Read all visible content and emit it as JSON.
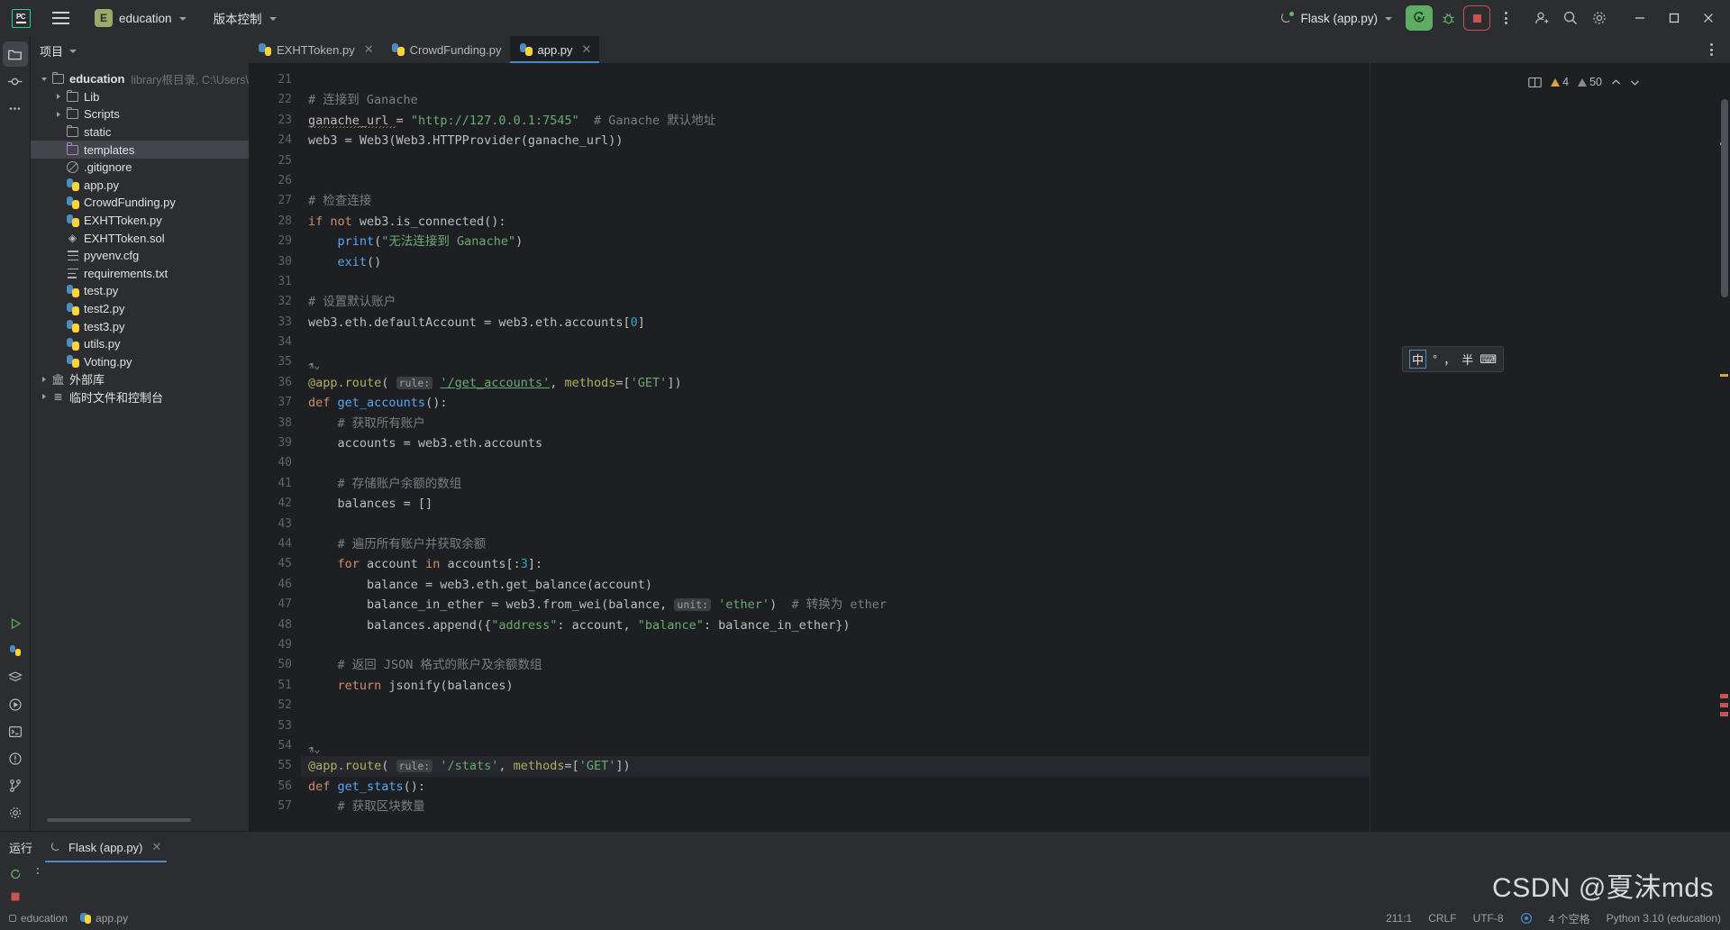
{
  "titlebar": {
    "logo_text": "PC",
    "menu_icon": "hamburger-menu-icon",
    "project_badge": "E",
    "project_name": "education",
    "vcs_label": "版本控制",
    "run_config": "Flask (app.py)",
    "run_icon": "run-with-reload-icon",
    "debug_icon": "debug-icon",
    "stop_icon": "stop-icon",
    "more_icon": "more-actions-icon",
    "account_icon": "account-icon",
    "search_icon": "search-icon",
    "settings_icon": "settings-gear-icon",
    "minimize": "—",
    "maximize": "▢",
    "close": "✕"
  },
  "rail": {
    "items": [
      {
        "name": "project-tool-window",
        "icon": "folder-icon"
      },
      {
        "name": "commit-tool-window",
        "icon": "commit-icon"
      },
      {
        "name": "more-tool-windows",
        "icon": "ellipsis-icon"
      }
    ],
    "bottom_items": [
      {
        "name": "run-tool-window",
        "icon": "run-icon"
      },
      {
        "name": "python-packages",
        "icon": "python-icon"
      },
      {
        "name": "python-console",
        "icon": "stack-icon"
      },
      {
        "name": "services",
        "icon": "services-icon"
      },
      {
        "name": "terminal",
        "icon": "terminal-icon"
      },
      {
        "name": "problems",
        "icon": "problems-icon"
      },
      {
        "name": "version-control",
        "icon": "branch-icon"
      },
      {
        "name": "settings",
        "icon": "gear-icon"
      }
    ]
  },
  "sidebar": {
    "header": "项目",
    "tree": [
      {
        "label": "education",
        "sub": "library根目录, C:\\Users\\jack\\D",
        "icon": "folder-icon",
        "depth": 0,
        "arrow": "open",
        "bold": true
      },
      {
        "label": "Lib",
        "sub": "",
        "icon": "folder-icon",
        "depth": 1,
        "arrow": "closed",
        "bold": false
      },
      {
        "label": "Scripts",
        "sub": "",
        "icon": "folder-icon",
        "depth": 1,
        "arrow": "closed",
        "bold": false
      },
      {
        "label": "static",
        "sub": "",
        "icon": "folder-icon",
        "depth": 1,
        "arrow": "none",
        "bold": false
      },
      {
        "label": "templates",
        "sub": "",
        "icon": "folder-purple-icon",
        "depth": 1,
        "arrow": "none",
        "bold": false,
        "selected": true
      },
      {
        "label": ".gitignore",
        "sub": "",
        "icon": "gitignore-icon",
        "depth": 1,
        "arrow": "none",
        "bold": false
      },
      {
        "label": "app.py",
        "sub": "",
        "icon": "python-file-icon",
        "depth": 1,
        "arrow": "none",
        "bold": false
      },
      {
        "label": "CrowdFunding.py",
        "sub": "",
        "icon": "python-file-icon",
        "depth": 1,
        "arrow": "none",
        "bold": false
      },
      {
        "label": "EXHTToken.py",
        "sub": "",
        "icon": "python-file-icon",
        "depth": 1,
        "arrow": "none",
        "bold": false
      },
      {
        "label": "EXHTToken.sol",
        "sub": "",
        "icon": "solidity-file-icon",
        "depth": 1,
        "arrow": "none",
        "bold": false
      },
      {
        "label": "pyvenv.cfg",
        "sub": "",
        "icon": "config-file-icon",
        "depth": 1,
        "arrow": "none",
        "bold": false
      },
      {
        "label": "requirements.txt",
        "sub": "",
        "icon": "text-file-icon",
        "depth": 1,
        "arrow": "none",
        "bold": false
      },
      {
        "label": "test.py",
        "sub": "",
        "icon": "python-file-icon",
        "depth": 1,
        "arrow": "none",
        "bold": false
      },
      {
        "label": "test2.py",
        "sub": "",
        "icon": "python-file-icon",
        "depth": 1,
        "arrow": "none",
        "bold": false
      },
      {
        "label": "test3.py",
        "sub": "",
        "icon": "python-file-icon",
        "depth": 1,
        "arrow": "none",
        "bold": false
      },
      {
        "label": "utils.py",
        "sub": "",
        "icon": "python-file-icon",
        "depth": 1,
        "arrow": "none",
        "bold": false
      },
      {
        "label": "Voting.py",
        "sub": "",
        "icon": "python-file-icon",
        "depth": 1,
        "arrow": "none",
        "bold": false
      },
      {
        "label": "外部库",
        "sub": "",
        "icon": "external-libraries-icon",
        "depth": 0,
        "arrow": "closed",
        "bold": false
      },
      {
        "label": "临时文件和控制台",
        "sub": "",
        "icon": "scratches-icon",
        "depth": 0,
        "arrow": "closed",
        "bold": false
      }
    ]
  },
  "tabs": [
    {
      "label": "EXHTToken.py",
      "icon": "python-file-icon",
      "active": false,
      "closable": true
    },
    {
      "label": "CrowdFunding.py",
      "icon": "python-file-icon",
      "active": false,
      "closable": false
    },
    {
      "label": "app.py",
      "icon": "python-file-icon",
      "active": true,
      "closable": true
    }
  ],
  "editor": {
    "first_line_number": 21,
    "lines": [
      {
        "n": 21,
        "tokens": []
      },
      {
        "n": 22,
        "tokens": [
          {
            "t": "# 连接到 Ganache",
            "c": "cmt"
          }
        ]
      },
      {
        "n": 23,
        "tokens": [
          {
            "t": "ganache_url ",
            "c": "id",
            "squiggle": true
          },
          {
            "t": "= ",
            "c": "id"
          },
          {
            "t": "\"http://127.0.0.1:7545\"",
            "c": "str"
          },
          {
            "t": "  # Ganache 默认地址",
            "c": "cmt"
          }
        ]
      },
      {
        "n": 24,
        "tokens": [
          {
            "t": "web3 = Web3(Web3.HTTPProvider(ganache_url))",
            "c": "id"
          }
        ]
      },
      {
        "n": 25,
        "tokens": []
      },
      {
        "n": 26,
        "tokens": []
      },
      {
        "n": 27,
        "tokens": [
          {
            "t": "# 检查连接",
            "c": "cmt"
          }
        ]
      },
      {
        "n": 28,
        "tokens": [
          {
            "t": "if not ",
            "c": "kw"
          },
          {
            "t": "web3.is_connected():",
            "c": "id"
          }
        ]
      },
      {
        "n": 29,
        "tokens": [
          {
            "t": "    ",
            "c": "id"
          },
          {
            "t": "print",
            "c": "fn"
          },
          {
            "t": "(",
            "c": "id"
          },
          {
            "t": "\"无法连接到 Ganache\"",
            "c": "str"
          },
          {
            "t": ")",
            "c": "id"
          }
        ]
      },
      {
        "n": 30,
        "tokens": [
          {
            "t": "    ",
            "c": "id"
          },
          {
            "t": "exit",
            "c": "fn"
          },
          {
            "t": "()",
            "c": "id"
          }
        ]
      },
      {
        "n": 31,
        "tokens": []
      },
      {
        "n": 32,
        "tokens": [
          {
            "t": "# 设置默认账户",
            "c": "cmt"
          }
        ]
      },
      {
        "n": 33,
        "tokens": [
          {
            "t": "web3.eth.defaultAccount = web3.eth.accounts[",
            "c": "id"
          },
          {
            "t": "0",
            "c": "num"
          },
          {
            "t": "]",
            "c": "id"
          }
        ]
      },
      {
        "n": 34,
        "tokens": []
      },
      {
        "n": 35,
        "tokens": []
      },
      {
        "n": 36,
        "tokens": [
          {
            "t": "@app.route",
            "c": "dec"
          },
          {
            "t": "( ",
            "c": "id"
          },
          {
            "t": "rule:",
            "c": "hint"
          },
          {
            "t": " ",
            "c": "id"
          },
          {
            "t": "'/get_accounts'",
            "c": "str-url"
          },
          {
            "t": ", ",
            "c": "id"
          },
          {
            "t": "methods",
            "c": "dec"
          },
          {
            "t": "=[",
            "c": "id"
          },
          {
            "t": "'GET'",
            "c": "str"
          },
          {
            "t": "])",
            "c": "id"
          }
        ],
        "gutter_run": true
      },
      {
        "n": 37,
        "tokens": [
          {
            "t": "def ",
            "c": "kw"
          },
          {
            "t": "get_accounts",
            "c": "fn"
          },
          {
            "t": "():",
            "c": "id"
          }
        ]
      },
      {
        "n": 38,
        "tokens": [
          {
            "t": "    # 获取所有账户",
            "c": "cmt"
          }
        ]
      },
      {
        "n": 39,
        "tokens": [
          {
            "t": "    accounts = web3.eth.accounts",
            "c": "id"
          }
        ]
      },
      {
        "n": 40,
        "tokens": []
      },
      {
        "n": 41,
        "tokens": [
          {
            "t": "    # 存储账户余额的数组",
            "c": "cmt"
          }
        ]
      },
      {
        "n": 42,
        "tokens": [
          {
            "t": "    balances = []",
            "c": "id"
          }
        ]
      },
      {
        "n": 43,
        "tokens": []
      },
      {
        "n": 44,
        "tokens": [
          {
            "t": "    # 遍历所有账户并获取余额",
            "c": "cmt"
          }
        ]
      },
      {
        "n": 45,
        "tokens": [
          {
            "t": "    ",
            "c": "id"
          },
          {
            "t": "for ",
            "c": "kw"
          },
          {
            "t": "account ",
            "c": "id"
          },
          {
            "t": "in ",
            "c": "kw"
          },
          {
            "t": "accounts[:",
            "c": "id"
          },
          {
            "t": "3",
            "c": "num"
          },
          {
            "t": "]:",
            "c": "id"
          }
        ]
      },
      {
        "n": 46,
        "tokens": [
          {
            "t": "        balance = web3.eth.get_balance(account)",
            "c": "id"
          }
        ]
      },
      {
        "n": 47,
        "tokens": [
          {
            "t": "        balance_in_ether = web3.from_wei(balance, ",
            "c": "id"
          },
          {
            "t": "unit:",
            "c": "hint"
          },
          {
            "t": " ",
            "c": "id"
          },
          {
            "t": "'ether'",
            "c": "str"
          },
          {
            "t": ")  ",
            "c": "id"
          },
          {
            "t": "# 转换为 ether",
            "c": "cmt"
          }
        ]
      },
      {
        "n": 48,
        "tokens": [
          {
            "t": "        balances.append({",
            "c": "id"
          },
          {
            "t": "\"address\"",
            "c": "str"
          },
          {
            "t": ": account, ",
            "c": "id"
          },
          {
            "t": "\"balance\"",
            "c": "str"
          },
          {
            "t": ": balance_in_ether})",
            "c": "id"
          }
        ]
      },
      {
        "n": 49,
        "tokens": []
      },
      {
        "n": 50,
        "tokens": [
          {
            "t": "    # 返回 JSON 格式的账户及余额数组",
            "c": "cmt"
          }
        ]
      },
      {
        "n": 51,
        "tokens": [
          {
            "t": "    ",
            "c": "id"
          },
          {
            "t": "return ",
            "c": "kw"
          },
          {
            "t": "jsonify(balances)",
            "c": "id"
          }
        ]
      },
      {
        "n": 52,
        "tokens": []
      },
      {
        "n": 53,
        "tokens": []
      },
      {
        "n": 54,
        "tokens": []
      },
      {
        "n": 55,
        "tokens": [
          {
            "t": "@app.route",
            "c": "dec"
          },
          {
            "t": "( ",
            "c": "id"
          },
          {
            "t": "rule:",
            "c": "hint"
          },
          {
            "t": " ",
            "c": "id"
          },
          {
            "t": "'/stats'",
            "c": "str"
          },
          {
            "t": ", ",
            "c": "id"
          },
          {
            "t": "methods",
            "c": "dec"
          },
          {
            "t": "=[",
            "c": "id"
          },
          {
            "t": "'GET'",
            "c": "str"
          },
          {
            "t": "])",
            "c": "id"
          }
        ],
        "gutter_run": true,
        "highlight": true
      },
      {
        "n": 56,
        "tokens": [
          {
            "t": "def ",
            "c": "kw"
          },
          {
            "t": "get_stats",
            "c": "fn"
          },
          {
            "t": "():",
            "c": "id"
          }
        ]
      },
      {
        "n": 57,
        "tokens": [
          {
            "t": "    # 获取区块数量",
            "c": "cmt"
          }
        ]
      }
    ],
    "inspections": {
      "warning_count": "4",
      "weak_warning_count": "50",
      "reader_mode_icon": "reader-mode-icon",
      "up_icon": "previous-problem-icon",
      "down_icon": "next-problem-icon"
    }
  },
  "ime_popup": {
    "chars": [
      "中",
      "°",
      "，",
      "半",
      "⌨"
    ],
    "active_char": "中"
  },
  "run_panel": {
    "title": "运行",
    "tab_label": "Flask (app.py)",
    "tab_icon": "flask-icon",
    "close_icon": "close-icon",
    "rerun_icon": "rerun-icon",
    "stop_icon": "stop-icon"
  },
  "statusbar": {
    "left_items": [
      {
        "label": "education",
        "icon": "project-icon"
      },
      {
        "label": "app.py",
        "icon": "python-file-icon"
      }
    ],
    "caret_position": "211:1",
    "line_separator": "CRLF",
    "encoding": "UTF-8",
    "indent": "4 个空格",
    "interpreter": "Python 3.10 (education)",
    "inspection_icon": "inspections-icon"
  },
  "watermark": "CSDN @夏沫mds",
  "colors": {
    "bg_dark": "#1e1f22",
    "bg_panel": "#2b2d30",
    "accent_blue": "#4a88c7",
    "run_green": "#5fad65",
    "stop_red": "#c75450",
    "string_green": "#6aab73",
    "keyword_orange": "#cf8e6d",
    "number_cyan": "#2aacb8",
    "function_blue": "#56a8f5",
    "comment_gray": "#7a7e85",
    "decorator_yellow": "#b3ae60",
    "warning_yellow": "#d9a343"
  }
}
